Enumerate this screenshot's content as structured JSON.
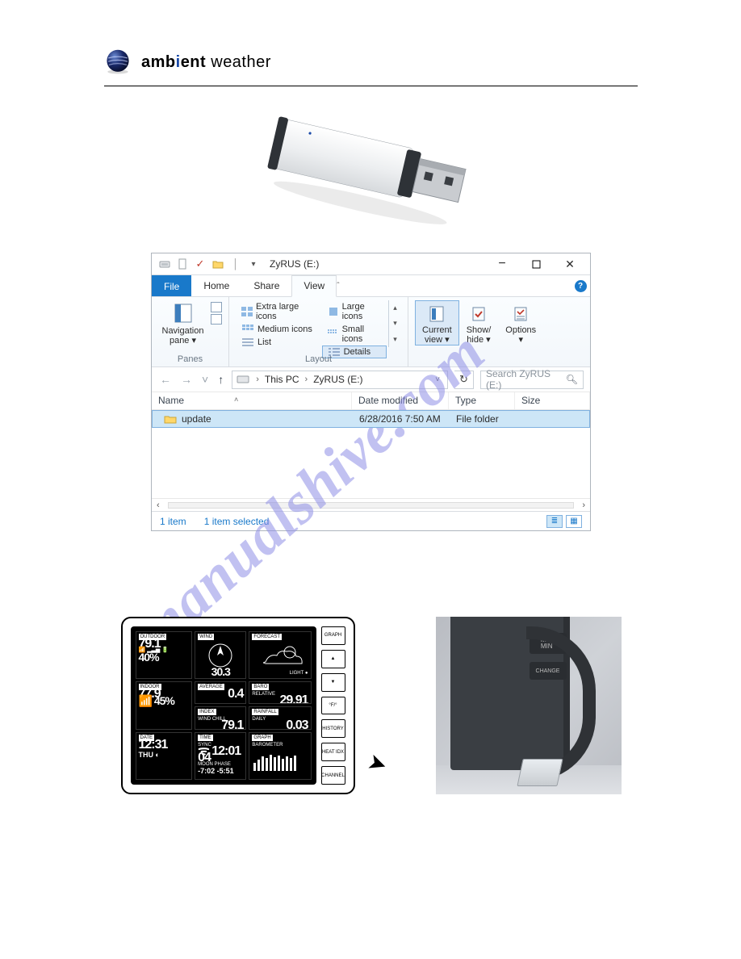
{
  "logo": {
    "brand_bold": "amb",
    "brand_accent": "i",
    "brand_bold2": "ent",
    "brand_thin": " weather"
  },
  "watermark": "manualshive.com",
  "explorer": {
    "title": "ZyRUS (E:)",
    "qat_icons": [
      "drive",
      "doc",
      "check",
      "folder",
      "sep"
    ],
    "window_controls": {
      "min": "−",
      "max": "▢",
      "close": "✕"
    },
    "tabs": {
      "file": "File",
      "home": "Home",
      "share": "Share",
      "view": "View"
    },
    "help_min_caret": "ˆ",
    "ribbon": {
      "panes": {
        "label": "Panes",
        "nav_pane": "Navigation\npane ▾"
      },
      "layout": {
        "label": "Layout",
        "items_left": [
          "Extra large icons",
          "Medium icons",
          "List"
        ],
        "items_right": [
          "Large icons",
          "Small icons",
          "Details"
        ],
        "selected": "Details"
      },
      "current_view": "Current\nview ▾",
      "show_hide": "Show/\nhide ▾",
      "options": "Options\n▾"
    },
    "address": {
      "back": "←",
      "fwd": "→",
      "recent": "˅",
      "up": "↑",
      "crumb1": "This PC",
      "crumb2": "ZyRUS (E:)",
      "search_placeholder": "Search ZyRUS (E:)"
    },
    "columns": {
      "name": "Name",
      "date": "Date modified",
      "type": "Type",
      "size": "Size"
    },
    "rows": [
      {
        "name": "update",
        "date": "6/28/2016 7:50 AM",
        "type": "File folder",
        "size": ""
      }
    ],
    "status": {
      "count": "1 item",
      "selected": "1 item selected"
    }
  },
  "console": {
    "buttons": [
      "GRAPH",
      "▲",
      "▼",
      "°F/°",
      "HISTORY",
      "HEAT IDX",
      "CHANNEL"
    ],
    "cells": {
      "outdoor": {
        "label": "OUTDOOR",
        "temp": "79.1",
        "hum": "40"
      },
      "wind": {
        "label": "WIND",
        "val": "30.3"
      },
      "forecast": {
        "label": "FORECAST"
      },
      "indoor": {
        "label": "INDOOR",
        "temp": "77.9",
        "hum": "45"
      },
      "average": {
        "label": "AVERAGE",
        "val": "0.4"
      },
      "baro": {
        "label": "BARO",
        "val": "29.91",
        "sub": "RELATIVE"
      },
      "index": {
        "label": "INDEX",
        "sub": "WIND CHILL",
        "val": "79.1"
      },
      "rainfall": {
        "label": "RAINFALL",
        "sub": "DAILY",
        "val": "0.03"
      },
      "date": {
        "label": "DATE",
        "val": "12:31",
        "day": "THU"
      },
      "time": {
        "label": "TIME",
        "sub": "SYNC",
        "val": "12:01 04",
        "moon": "-7:02  -5:51",
        "moonlbl": "MOON PHASE"
      },
      "graph": {
        "label": "GRAPH",
        "sub": "BAROMETER"
      }
    }
  },
  "photo": {
    "btn_top": "MAX\nMIN",
    "btn_mid": "CHANGE"
  }
}
